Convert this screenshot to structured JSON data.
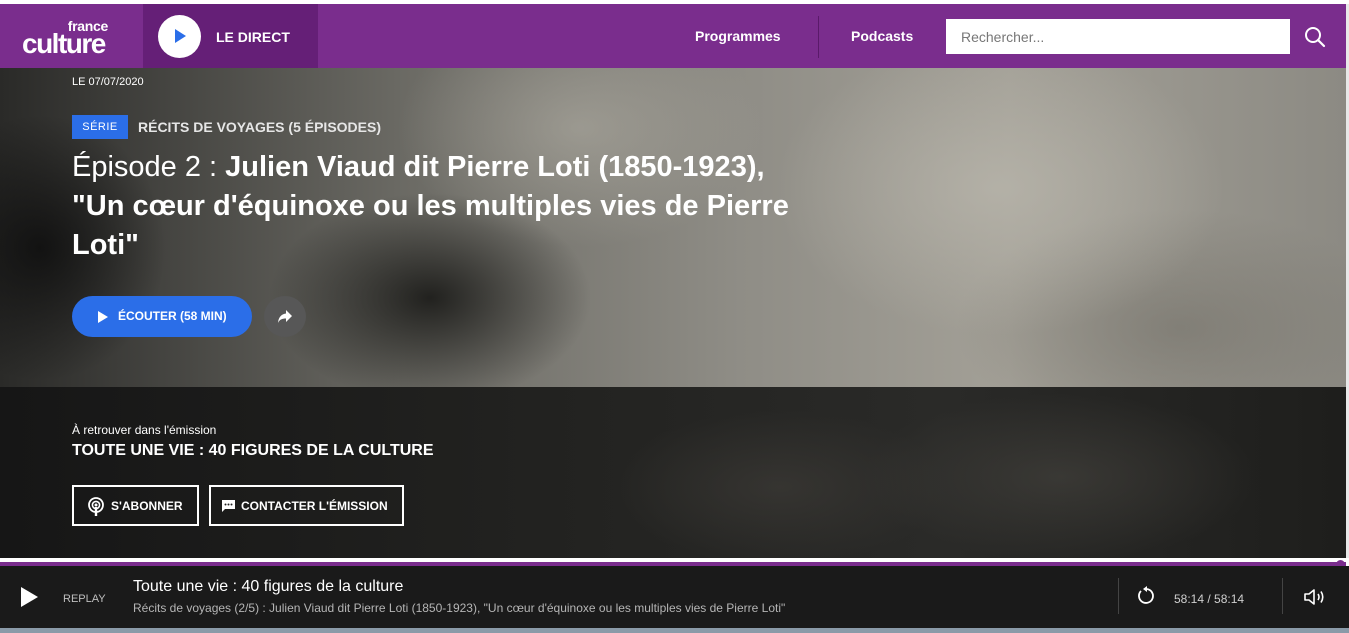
{
  "header": {
    "logo_top": "france",
    "logo_main": "culture",
    "direct_label": "LE DIRECT",
    "nav": [
      "Programmes",
      "Podcasts"
    ],
    "search_placeholder": "Rechercher...",
    "colors": {
      "brand": "#7a2d8d",
      "brand_dark": "#651f77",
      "accent": "#2b6ee8"
    }
  },
  "hero": {
    "date": "LE 07/07/2020",
    "badge": "SÉRIE",
    "serie": "RÉCITS DE VOYAGES (5 ÉPISODES)",
    "episode_prefix": "Épisode 2 : ",
    "episode_title": "Julien Viaud dit Pierre Loti (1850-1923), \"Un cœur d'équinoxe ou les multiples vies de Pierre Loti\"",
    "listen_label": "ÉCOUTER (58 MIN)",
    "share_icon": "share-icon",
    "retrouver": "À retrouver dans l'émission",
    "emission": "TOUTE UNE VIE : 40 FIGURES DE LA CULTURE",
    "subscribe_label": "S'ABONNER",
    "contact_label": "CONTACTER L'ÉMISSION"
  },
  "player": {
    "mode": "REPLAY",
    "title": "Toute une vie : 40 figures de la culture",
    "subtitle": "Récits de voyages (2/5) : Julien Viaud dit Pierre Loti (1850-1923), \"Un cœur d'équinoxe ou les multiples vies de Pierre Loti\"",
    "time": "58:14 / 58:14",
    "progress": 1.0
  }
}
